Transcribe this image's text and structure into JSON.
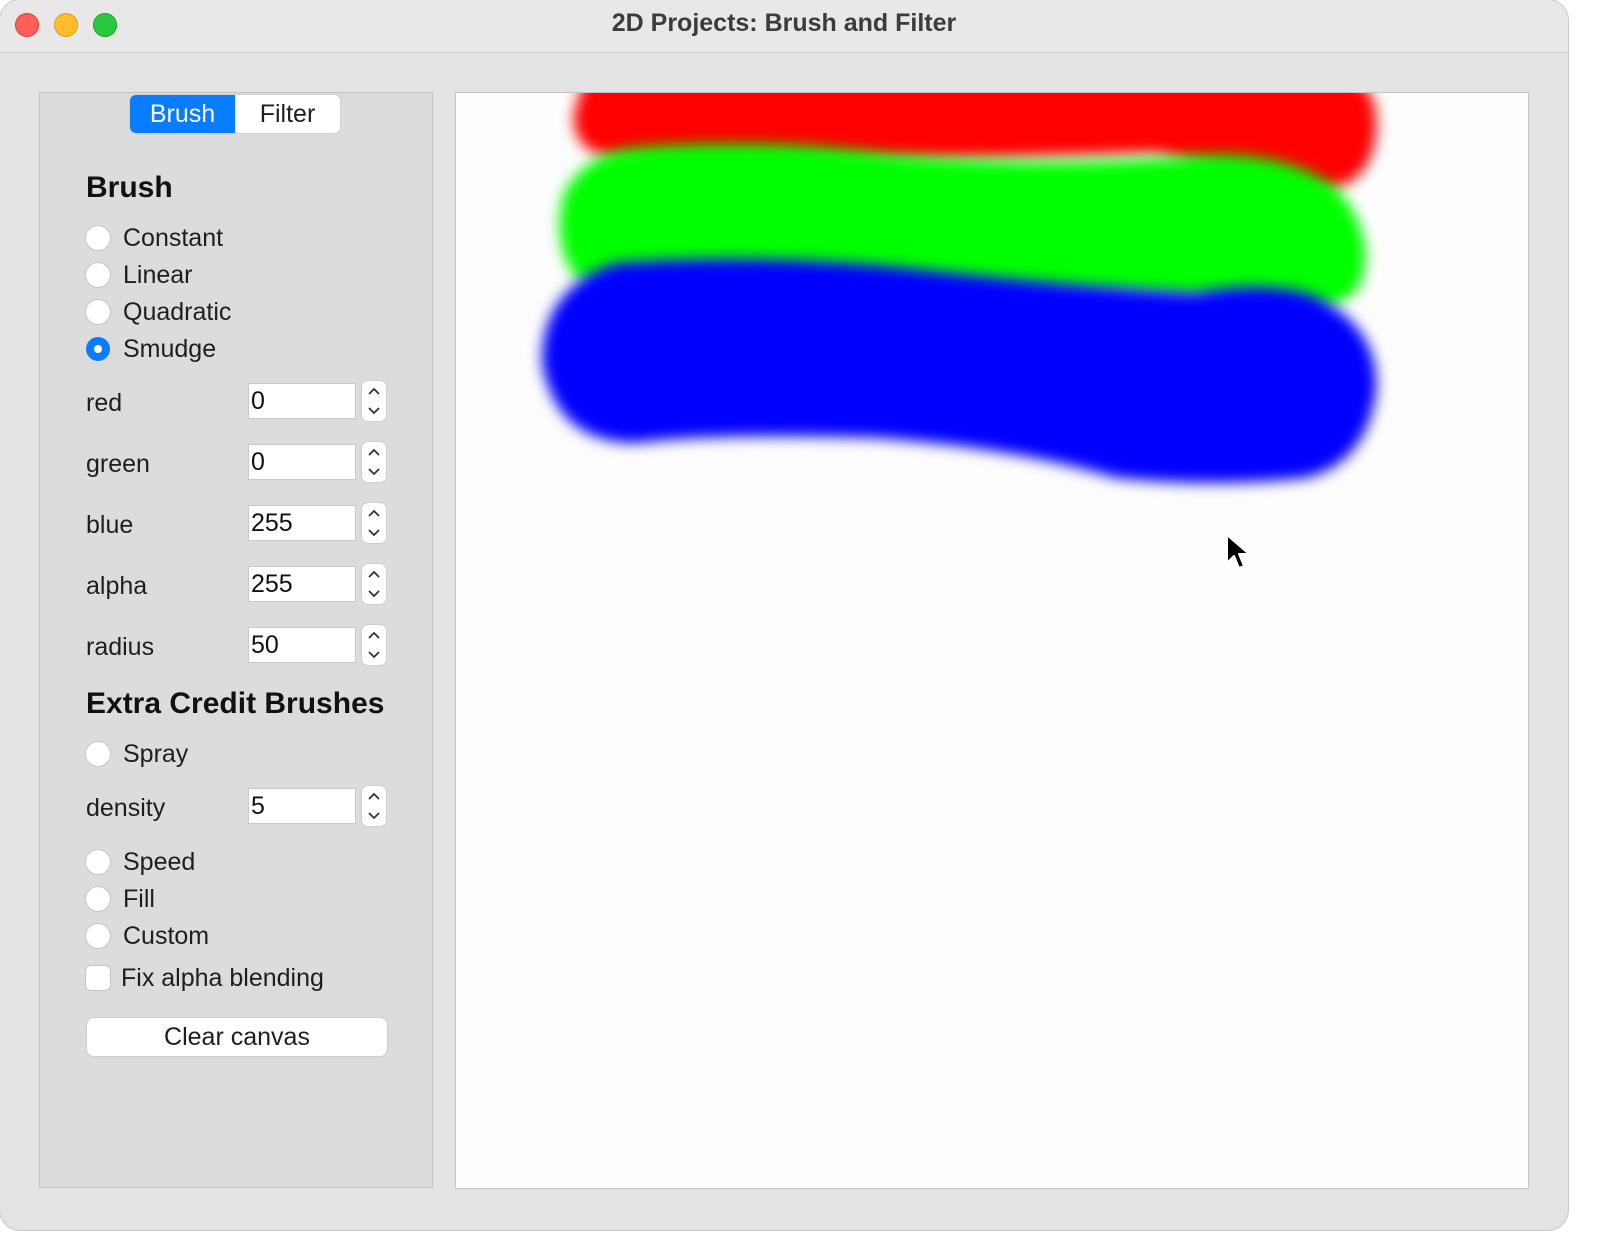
{
  "window": {
    "title": "2D Projects: Brush and Filter"
  },
  "tabs": [
    {
      "label": "Brush",
      "active": true
    },
    {
      "label": "Filter",
      "active": false
    }
  ],
  "brush": {
    "heading": "Brush",
    "options": [
      {
        "label": "Constant",
        "selected": false
      },
      {
        "label": "Linear",
        "selected": false
      },
      {
        "label": "Quadratic",
        "selected": false
      },
      {
        "label": "Smudge",
        "selected": true
      }
    ],
    "fields": [
      {
        "label": "red",
        "value": "0"
      },
      {
        "label": "green",
        "value": "0"
      },
      {
        "label": "blue",
        "value": "255"
      },
      {
        "label": "alpha",
        "value": "255"
      },
      {
        "label": "radius",
        "value": "50"
      }
    ]
  },
  "extra": {
    "heading": "Extra Credit Brushes",
    "spray_label": "Spray",
    "density_label": "density",
    "density_value": "5",
    "options": [
      {
        "label": "Speed",
        "selected": false
      },
      {
        "label": "Fill",
        "selected": false
      },
      {
        "label": "Custom",
        "selected": false
      }
    ],
    "fix_alpha_label": "Fix alpha blending",
    "fix_alpha_checked": false,
    "clear_label": "Clear canvas"
  },
  "colors": {
    "accent": "#0a7cff",
    "stroke_red": "#ff0000",
    "stroke_green": "#00ff00",
    "stroke_blue": "#0000ff"
  }
}
